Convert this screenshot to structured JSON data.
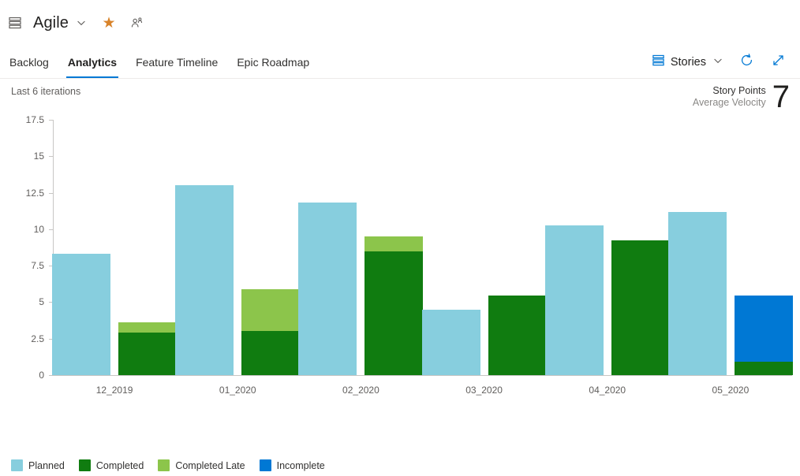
{
  "header": {
    "stack_icon": "stack-icon",
    "project": "Agile",
    "chevron_icon": "chevron-down-icon",
    "favorite_icon": "star-filled-icon",
    "favorite_color": "#d8832a",
    "team_icon": "people-team-icon"
  },
  "tabs": [
    {
      "label": "Backlog",
      "active": false
    },
    {
      "label": "Analytics",
      "active": true
    },
    {
      "label": "Feature Timeline",
      "active": false
    },
    {
      "label": "Epic Roadmap",
      "active": false
    }
  ],
  "toolbar": {
    "pivot_icon": "stack-blue-icon",
    "pivot_label": "Stories",
    "pivot_chevron_icon": "chevron-down-icon",
    "refresh_icon": "refresh-icon",
    "fullscreen_icon": "expand-diagonal-icon",
    "accent": "#0078d4"
  },
  "subheader": {
    "range_label": "Last 6 iterations",
    "velocity_title": "Story Points",
    "velocity_subtitle": "Average Velocity",
    "velocity_value": "7"
  },
  "chart_data": {
    "type": "bar",
    "title": "",
    "xlabel": "",
    "ylabel": "",
    "ylim": [
      0,
      17.5
    ],
    "yticks": [
      "0",
      "2.5",
      "5",
      "7.5",
      "10",
      "12.5",
      "15",
      "17.5"
    ],
    "ytick_values": [
      0,
      2.5,
      5,
      7.5,
      10,
      12.5,
      15,
      17.5
    ],
    "grid": false,
    "legend_position": "bottom-left",
    "categories": [
      "12_2019",
      "01_2020",
      "02_2020",
      "03_2020",
      "04_2020",
      "05_2020"
    ],
    "series": [
      {
        "name": "Planned",
        "color": "#87cede",
        "values": [
          8.3,
          13.0,
          11.85,
          4.5,
          10.25,
          11.2
        ]
      },
      {
        "name": "Completed",
        "color": "#107c10",
        "values": [
          2.9,
          3.0,
          8.5,
          5.45,
          9.25,
          0.9
        ]
      },
      {
        "name": "Completed Late",
        "color": "#8cc54b",
        "values": [
          0.7,
          2.9,
          1.0,
          0,
          0,
          0
        ]
      },
      {
        "name": "Incomplete",
        "color": "#0078d4",
        "values": [
          0,
          0,
          0,
          0,
          0,
          4.55
        ]
      }
    ],
    "stack_groups": {
      "Planned": "planned",
      "Completed": "actual",
      "Completed Late": "actual",
      "Incomplete": "actual"
    }
  },
  "legend": [
    {
      "label": "Planned",
      "color": "#87cede"
    },
    {
      "label": "Completed",
      "color": "#107c10"
    },
    {
      "label": "Completed Late",
      "color": "#8cc54b"
    },
    {
      "label": "Incomplete",
      "color": "#0078d4"
    }
  ]
}
